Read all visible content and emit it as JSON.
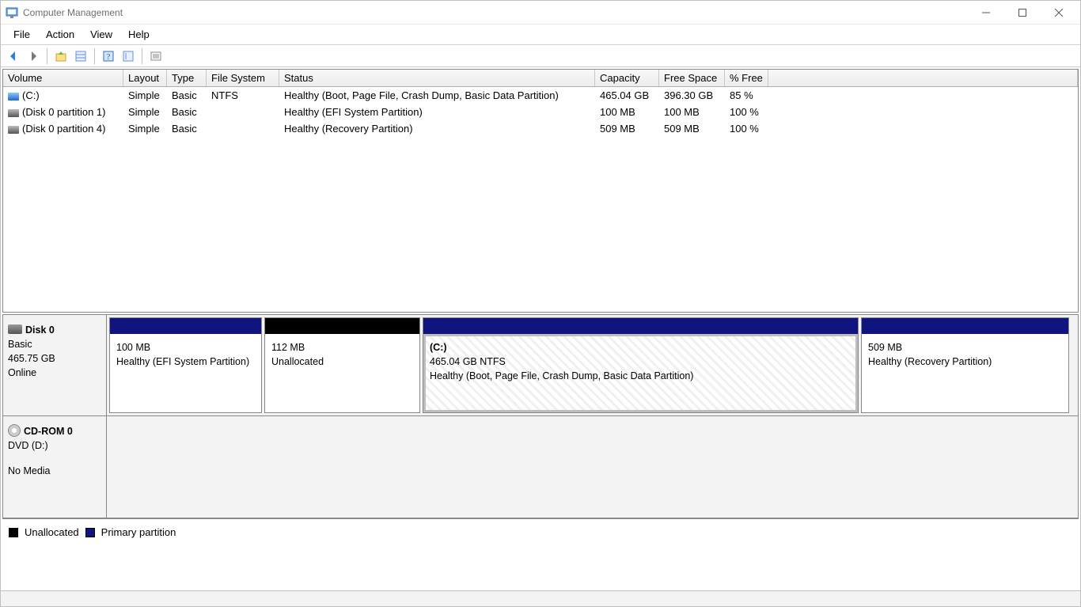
{
  "window": {
    "title": "Computer Management"
  },
  "menubar": {
    "file": "File",
    "action": "Action",
    "view": "View",
    "help": "Help"
  },
  "columns": {
    "volume": "Volume",
    "layout": "Layout",
    "type": "Type",
    "fs": "File System",
    "status": "Status",
    "capacity": "Capacity",
    "free": "Free Space",
    "pfree": "% Free"
  },
  "volumes": [
    {
      "name": "(C:)",
      "iconClass": "drive",
      "layout": "Simple",
      "type": "Basic",
      "fs": "NTFS",
      "status": "Healthy (Boot, Page File, Crash Dump, Basic Data Partition)",
      "capacity": "465.04 GB",
      "free": "396.30 GB",
      "pfree": "85 %"
    },
    {
      "name": "(Disk 0 partition 1)",
      "iconClass": "part",
      "layout": "Simple",
      "type": "Basic",
      "fs": "",
      "status": "Healthy (EFI System Partition)",
      "capacity": "100 MB",
      "free": "100 MB",
      "pfree": "100 %"
    },
    {
      "name": "(Disk 0 partition 4)",
      "iconClass": "part",
      "layout": "Simple",
      "type": "Basic",
      "fs": "",
      "status": "Healthy (Recovery Partition)",
      "capacity": "509 MB",
      "free": "509 MB",
      "pfree": "100 %"
    }
  ],
  "disks": {
    "disk0": {
      "title": "Disk 0",
      "type": "Basic",
      "size": "465.75 GB",
      "state": "Online"
    },
    "cdrom0": {
      "title": "CD-ROM 0",
      "type": "DVD (D:)",
      "state": "No Media"
    }
  },
  "partitions": [
    {
      "widthPx": 193,
      "headerClass": "hdr-primary",
      "selected": false,
      "title": "",
      "line1": "100 MB",
      "line2": "Healthy (EFI System Partition)"
    },
    {
      "widthPx": 197,
      "headerClass": "hdr-unalloc",
      "selected": false,
      "title": "",
      "line1": "112 MB",
      "line2": "Unallocated"
    },
    {
      "widthPx": 551,
      "headerClass": "hdr-primary",
      "selected": true,
      "title": "(C:)",
      "line1": "465.04 GB NTFS",
      "line2": "Healthy (Boot, Page File, Crash Dump, Basic Data Partition)"
    },
    {
      "widthPx": 263,
      "headerClass": "hdr-primary",
      "selected": false,
      "title": "",
      "line1": "509 MB",
      "line2": "Healthy (Recovery Partition)"
    }
  ],
  "legend": {
    "unallocated": "Unallocated",
    "primary": "Primary partition"
  }
}
